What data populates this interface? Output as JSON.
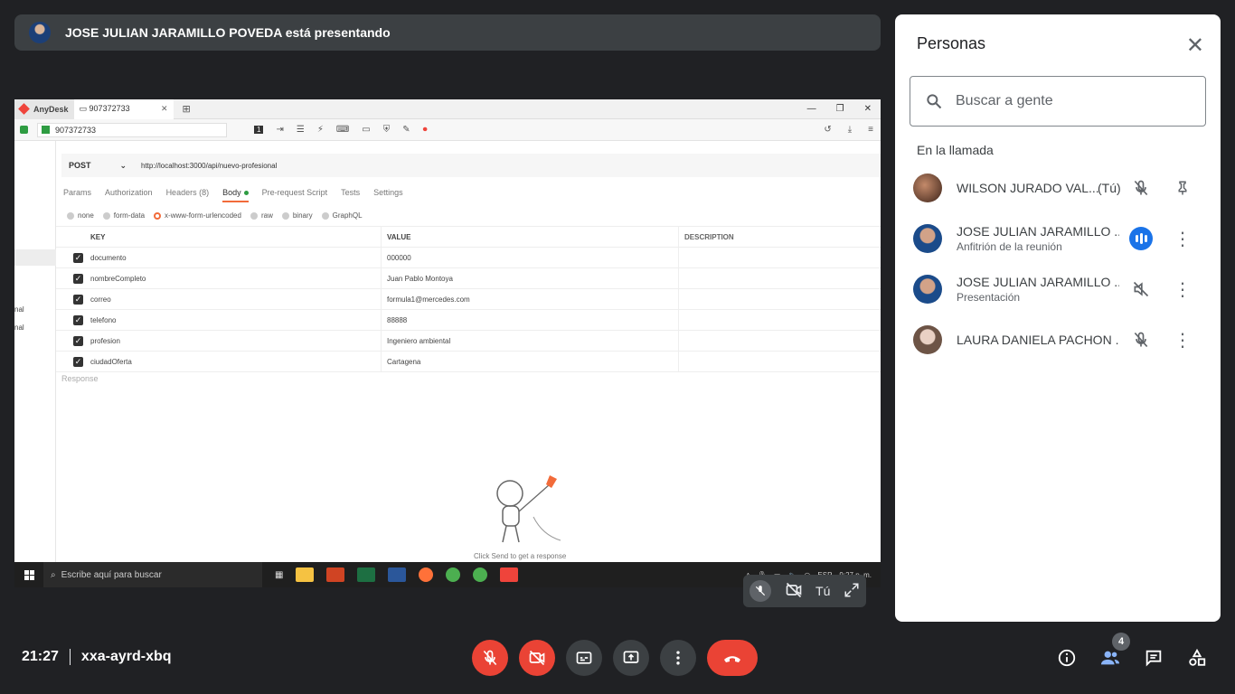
{
  "presenter": {
    "text": "JOSE JULIAN JARAMILLO POVEDA está presentando"
  },
  "anydesk": {
    "app_name": "AnyDesk",
    "tab_label": "907372733",
    "address": "907372733",
    "toolbar_num": "1"
  },
  "postman": {
    "method": "POST",
    "url": "http://localhost:3000/api/nuevo-profesional",
    "tabs": [
      "Params",
      "Authorization",
      "Headers (8)",
      "Body",
      "Pre-request Script",
      "Tests",
      "Settings"
    ],
    "body_types": [
      "none",
      "form-data",
      "x-www-form-urlencoded",
      "raw",
      "binary",
      "GraphQL"
    ],
    "columns": {
      "key": "KEY",
      "value": "VALUE",
      "description": "DESCRIPTION"
    },
    "rows": [
      {
        "key": "documento",
        "value": "000000"
      },
      {
        "key": "nombreCompleto",
        "value": "Juan Pablo Montoya"
      },
      {
        "key": "correo",
        "value": "formula1@mercedes.com"
      },
      {
        "key": "telefono",
        "value": "88888"
      },
      {
        "key": "profesion",
        "value": "Ingeniero ambiental"
      },
      {
        "key": "ciudadOferta",
        "value": "Cartagena"
      }
    ],
    "response_label": "Response",
    "hint": "Click Send to get a response",
    "sidebar_s1": "nal",
    "sidebar_s2": "nal"
  },
  "taskbar": {
    "search_placeholder": "Escribe aquí para buscar",
    "lang": "ESP",
    "time": "9:27 p. m."
  },
  "screen_ctrl": {
    "you_label": "Tú"
  },
  "panel": {
    "title": "Personas",
    "search_placeholder": "Buscar a gente",
    "section": "En la llamada",
    "people": [
      {
        "name": "WILSON JURADO VAL...",
        "tag": "(Tú)",
        "sub": ""
      },
      {
        "name": "JOSE JULIAN JARAMILLO ...",
        "tag": "",
        "sub": "Anfitrión de la reunión"
      },
      {
        "name": "JOSE JULIAN JARAMILLO ...",
        "tag": "",
        "sub": "Presentación"
      },
      {
        "name": "LAURA DANIELA PACHON ...",
        "tag": "",
        "sub": ""
      }
    ]
  },
  "bottom": {
    "time": "21:27",
    "meeting_code": "xxa-ayrd-xbq",
    "participants_count": "4"
  },
  "colors": {
    "red": "#ea4335",
    "blue": "#1a73e8",
    "bg": "#202124"
  }
}
